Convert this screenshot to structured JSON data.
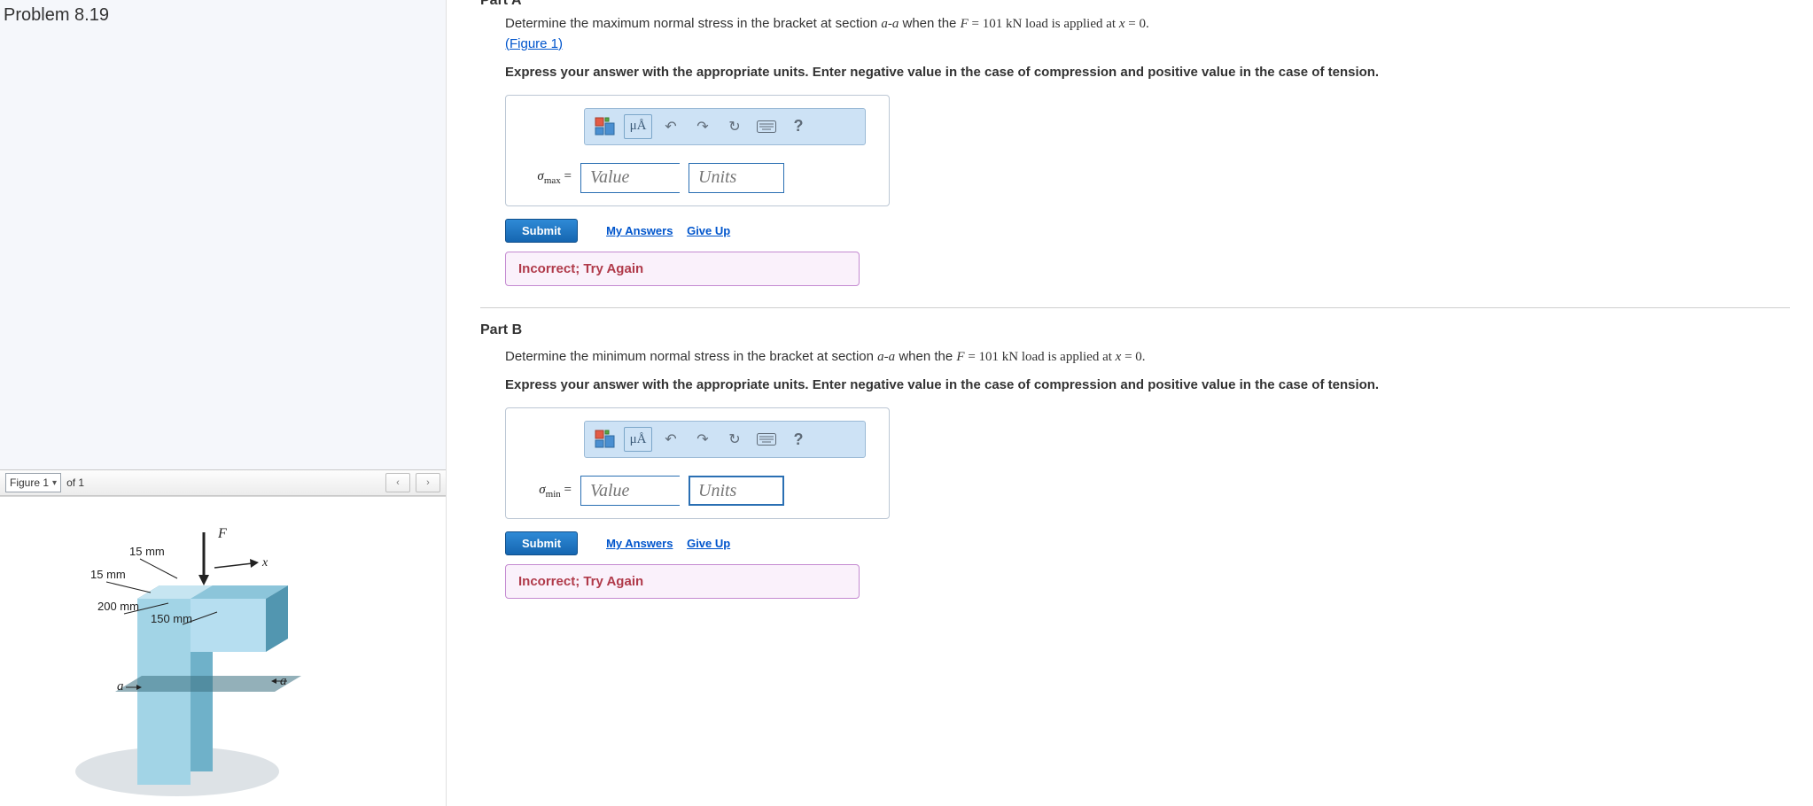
{
  "problem": {
    "title": "Problem 8.19"
  },
  "figure": {
    "selector_label": "Figure 1",
    "count_text": "of 1",
    "diagram": {
      "force_label": "F",
      "axis_label": "x",
      "dim_top1": "15 mm",
      "dim_top2": "15 mm",
      "dim_height": "200 mm",
      "dim_flange": "150 mm",
      "section_label_left": "a",
      "section_label_right": "a"
    }
  },
  "partA": {
    "header": "Part A",
    "prompt_pre": "Determine the maximum normal stress in the bracket at section ",
    "prompt_section": "a-a",
    "prompt_mid": " when the ",
    "force_var": "F",
    "prompt_eq": " = 101 kN load is applied at ",
    "x_var": "x",
    "x_val": " = 0.",
    "figure_link": "(Figure 1)",
    "instruction": "Express your answer with the appropriate units. Enter negative value in the case of compression and positive value in the case of tension.",
    "var_html": "σ",
    "var_sub": "max",
    "eq": " = ",
    "value_placeholder": "Value",
    "units_placeholder": "Units",
    "submit": "Submit",
    "my_answers": "My Answers",
    "give_up": "Give Up",
    "feedback": "Incorrect; Try Again",
    "toolbar": {
      "uA": "μÅ",
      "help": "?"
    }
  },
  "partB": {
    "header": "Part B",
    "prompt_pre": "Determine the minimum normal stress in the bracket at section ",
    "prompt_section": "a-a",
    "prompt_mid": " when the ",
    "force_var": "F",
    "prompt_eq": " = 101 kN load is applied at ",
    "x_var": "x",
    "x_val": " = 0.",
    "instruction": "Express your answer with the appropriate units. Enter negative value in the case of compression and positive value in the case of tension.",
    "var_html": "σ",
    "var_sub": "min",
    "eq": " = ",
    "value_placeholder": "Value",
    "units_placeholder": "Units",
    "submit": "Submit",
    "my_answers": "My Answers",
    "give_up": "Give Up",
    "feedback": "Incorrect; Try Again",
    "toolbar": {
      "uA": "μÅ",
      "help": "?"
    }
  }
}
